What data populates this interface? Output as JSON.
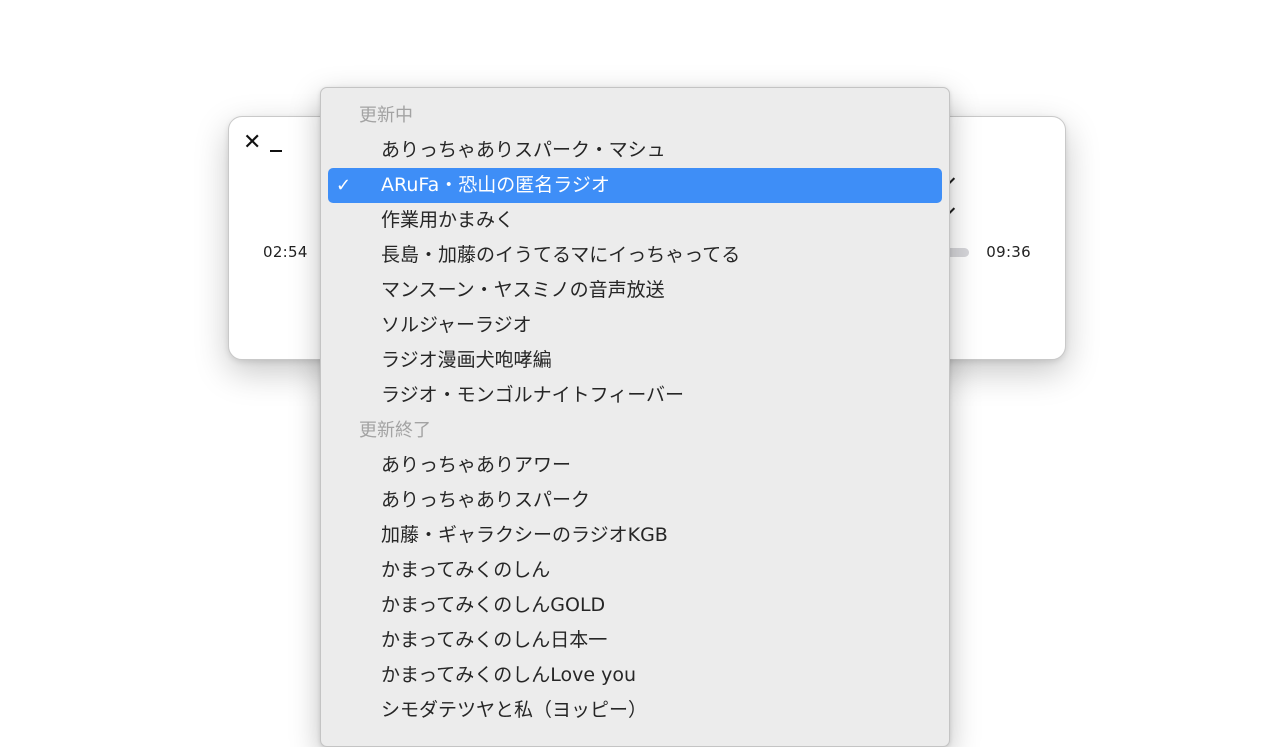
{
  "window": {
    "close_glyph": "✕",
    "elapsed_time": "02:54",
    "total_time": "09:36",
    "progress_fraction": 0.302
  },
  "menu": {
    "selected_check_glyph": "✓",
    "sections": [
      {
        "header": "更新中",
        "items": [
          {
            "label": "ありっちゃありスパーク・マシュ",
            "selected": false
          },
          {
            "label": "ARuFa・恐山の匿名ラジオ",
            "selected": true
          },
          {
            "label": "作業用かまみく",
            "selected": false
          },
          {
            "label": "長島・加藤のイうてるマにイっちゃってる",
            "selected": false
          },
          {
            "label": "マンスーン・ヤスミノの音声放送",
            "selected": false
          },
          {
            "label": "ソルジャーラジオ",
            "selected": false
          },
          {
            "label": "ラジオ漫画犬咆哮編",
            "selected": false
          },
          {
            "label": "ラジオ・モンゴルナイトフィーバー",
            "selected": false
          }
        ]
      },
      {
        "header": "更新終了",
        "items": [
          {
            "label": "ありっちゃありアワー",
            "selected": false
          },
          {
            "label": "ありっちゃありスパーク",
            "selected": false
          },
          {
            "label": "加藤・ギャラクシーのラジオKGB",
            "selected": false
          },
          {
            "label": "かまってみくのしん",
            "selected": false
          },
          {
            "label": "かまってみくのしんGOLD",
            "selected": false
          },
          {
            "label": "かまってみくのしん日本一",
            "selected": false
          },
          {
            "label": "かまってみくのしんLove you",
            "selected": false
          },
          {
            "label": "シモダテツヤと私（ヨッピー）",
            "selected": false
          }
        ]
      }
    ]
  }
}
